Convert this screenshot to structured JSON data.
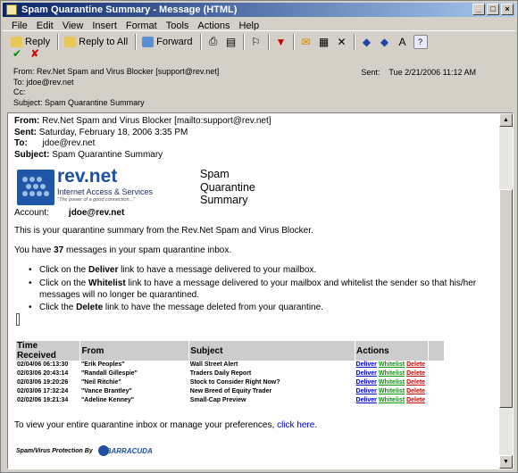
{
  "window": {
    "title": "Spam Quarantine Summary - Message (HTML)"
  },
  "menu": [
    "File",
    "Edit",
    "View",
    "Insert",
    "Format",
    "Tools",
    "Actions",
    "Help"
  ],
  "toolbar": {
    "reply": "Reply",
    "reply_all": "Reply to All",
    "forward": "Forward"
  },
  "header": {
    "from": "From:  Rev.Net Spam and Virus Blocker [support@rev.net]",
    "to": "To:   jdoe@rev.net",
    "cc": "Cc:",
    "subject": "Subject:  Spam Quarantine Summary",
    "sent_label": "Sent:",
    "sent_value": "Tue 2/21/2006 11:12 AM"
  },
  "message": {
    "from_label": "From:",
    "from_value": "Rev.Net Spam and Virus Blocker [mailto:support@rev.net]",
    "sent_label": "Sent:",
    "sent_value": "Saturday, February 18, 2006 3:35 PM",
    "to_label": "To:",
    "to_value": "jdoe@rev.net",
    "subject_label": "Subject:",
    "subject_value": "Spam Quarantine Summary"
  },
  "logo": {
    "name": "rev.net",
    "tagline": "Internet Access & Services",
    "slogan": "\"The power of a good connection...\""
  },
  "summary_title": "Spam Quarantine Summary",
  "account": {
    "label": "Account:",
    "value": "jdoe@rev.net"
  },
  "intro": "This is your quarantine summary from the Rev.Net Spam and Virus Blocker.",
  "count_line": {
    "prefix": "You have ",
    "count": "37",
    "suffix": " messages in your spam quarantine inbox."
  },
  "bullets": [
    {
      "pre": "Click on the ",
      "bold": "Deliver",
      "post": " link to have a message delivered to your mailbox."
    },
    {
      "pre": "Click on the ",
      "bold": "Whitelist",
      "post": " link to have a message delivered to your mailbox and whitelist the sender so that his/her messages will no longer be quarantined."
    },
    {
      "pre": "Click the ",
      "bold": "Delete",
      "post": " link to have the message deleted from your quarantine."
    }
  ],
  "table": {
    "headers": [
      "Time Received",
      "From",
      "Subject",
      "Actions"
    ],
    "rows": [
      {
        "time": "02/04/06 06:13:30",
        "from": "\"Erik Peoples\"",
        "subject": "Wall Street Alert"
      },
      {
        "time": "02/03/06 20:43:14",
        "from": "\"Randall Gillespie\"",
        "subject": "Traders Daily Report"
      },
      {
        "time": "02/03/06 19:20:26",
        "from": "\"Neil Ritchie\"",
        "subject": "Stock to Consider Right Now?"
      },
      {
        "time": "02/03/06 17:32:24",
        "from": "\"Vance Brantley\"",
        "subject": "New Breed of Equity Trader"
      },
      {
        "time": "02/02/06 19:21:34",
        "from": "\"Adeline Kenney\"",
        "subject": "Small-Cap Preview"
      }
    ],
    "actions": {
      "deliver": "Deliver",
      "whitelist": "Whitelist",
      "delete": "Delete"
    }
  },
  "footer": {
    "text": "To view your entire quarantine inbox or manage your preferences, ",
    "link": "click here",
    "end": "."
  },
  "protection": {
    "label": "Spam/Virus Protection By",
    "brand": "BARRACUDA"
  }
}
